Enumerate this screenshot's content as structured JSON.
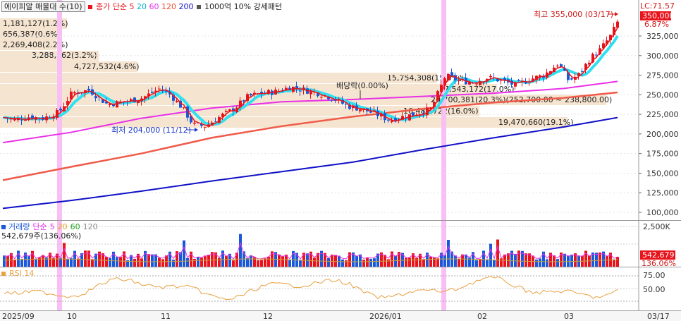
{
  "main": {
    "legend": {
      "symbol": "에이피알 매물대 수(10)",
      "ma_prefix": "종가 단순",
      "ma_periods": [
        "5",
        "20",
        "60",
        "120",
        "200"
      ],
      "ma_colors": [
        "#e8141c",
        "#00c8e8",
        "#e830e8",
        "#f05030",
        "#1010c8"
      ],
      "pattern": "1000억 10% 강세패턴"
    },
    "price_axis": [
      "325,000",
      "300,000",
      "275,000",
      "250,000",
      "225,000",
      "200,000",
      "175,000",
      "150,000",
      "125,000",
      "100,000"
    ],
    "lc_label": "LC:71.57",
    "current_price_label": "350,000",
    "current_pct_label": "6.87%",
    "high_label": "최고 355,000 (03/17)",
    "low_label": "최저 204,000 (11/12)",
    "dividend_label": "배당락(0.00%)",
    "volume_profile_labels": [
      "1,181,127(1.2%)",
      "656,387(0.6%)",
      "2,269,408(2.2%)",
      "3,288,862(3.2%)",
      "4,727,532(4.6%)",
      "15,754,308(15.3%)",
      "17,543,172(17.0%)",
      "20,700,381(20.3%)(252,700.00 ~ 238,800.00)",
      "16,486,722(16.0%)",
      "19,470,660(19.1%)"
    ]
  },
  "volume": {
    "legend": {
      "title": "거래량",
      "ma_prefix": "단순",
      "ma_periods": [
        "5",
        "20",
        "60",
        "120"
      ],
      "ma_colors": [
        "#e830e8",
        "#e8a020",
        "#20a020",
        "#888888"
      ],
      "current": "542,679주(136.06%)"
    },
    "axis_label": "2,500K",
    "current_value_label": "542,679",
    "current_pct_label": "136.06%"
  },
  "rsi": {
    "legend": "RSI 14",
    "axis_labels": [
      "75.00",
      "50.00"
    ]
  },
  "time_axis": {
    "labels": [
      "2025/09",
      "10",
      "11",
      "12",
      "2026/01",
      "02",
      "03"
    ],
    "right_label": "03/17"
  },
  "colors": {
    "up": "#e8141c",
    "down": "#1a58d8",
    "highlight": "#f9bff5",
    "band": "#f5e4cf"
  }
}
